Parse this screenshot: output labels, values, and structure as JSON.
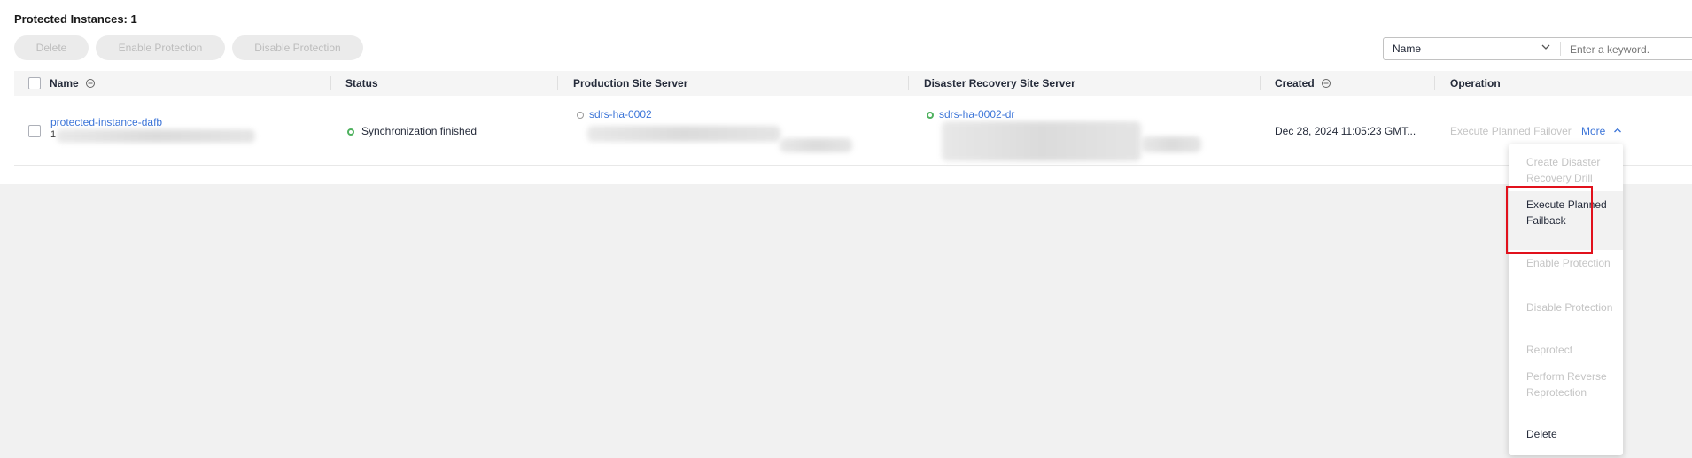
{
  "page": {
    "title": "Protected Instances: 1"
  },
  "toolbar": {
    "delete_label": "Delete",
    "enable_label": "Enable Protection",
    "disable_label": "Disable Protection"
  },
  "search": {
    "field_value": "Name",
    "placeholder": "Enter a keyword."
  },
  "table": {
    "headers": {
      "name": "Name",
      "status": "Status",
      "production": "Production Site Server",
      "dr": "Disaster Recovery Site Server",
      "created": "Created",
      "operation": "Operation"
    },
    "rows": [
      {
        "name": "protected-instance-dafb",
        "name_extra": "1",
        "status": "Synchronization finished",
        "production_server": "sdrs-ha-0002",
        "dr_server": "sdrs-ha-0002-dr",
        "created": "Dec 28, 2024 11:05:23 GMT...",
        "operation_primary": "Execute Planned Failover",
        "operation_more": "More"
      }
    ]
  },
  "more_menu": {
    "items": [
      {
        "label": "Create Disaster Recovery Drill",
        "enabled": false
      },
      {
        "label": "Execute Planned Failback",
        "enabled": true
      },
      {
        "label": "Enable Protection",
        "enabled": false
      },
      {
        "label": "Disable Protection",
        "enabled": false
      },
      {
        "label": "Reprotect",
        "enabled": false
      },
      {
        "label": "Perform Reverse Reprotection",
        "enabled": false
      },
      {
        "label": "Delete",
        "enabled": true
      }
    ]
  },
  "colors": {
    "link": "#3b74d8",
    "status_ok": "#4eb15e",
    "highlight": "#e1111c"
  },
  "icons": {
    "sort": "sort-icon",
    "chevron_down": "chevron-down-icon",
    "chevron_up": "chevron-up-icon",
    "status": "status-ring-icon"
  }
}
